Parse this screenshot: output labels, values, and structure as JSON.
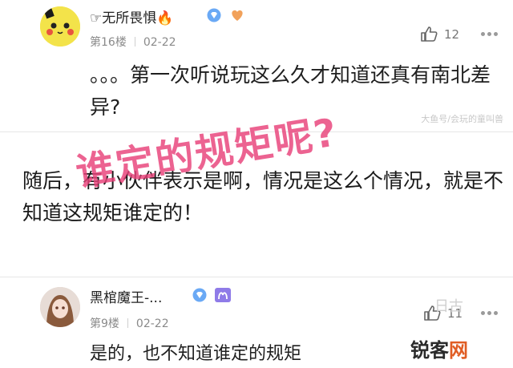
{
  "top_comment": {
    "username": "☞无所畏惧🔥",
    "floor": "第16楼",
    "date": "02-22",
    "likes": "12",
    "text": "。。。第一次听说玩这么久才知道还真有南北差异?",
    "watermark": "大鱼号/会玩的童叫兽"
  },
  "article": {
    "text": "随后，有小伙伴表示是啊，情况是这么个情况，就是不知道这规矩谁定的！"
  },
  "overlay": {
    "text": "谁定的规矩呢?",
    "color": "#e8427a"
  },
  "bottom_comment": {
    "username": "黑棺魔王-...",
    "floor": "第9楼",
    "date": "02-22",
    "likes": "11",
    "text": "是的，也不知道谁定的规矩",
    "watermark": "日古"
  },
  "site_logo": {
    "brand_part1": "锐客",
    "brand_part2": "网",
    "accent_color": "#e05d24"
  },
  "icons": [
    "avatar-pikachu",
    "fire-icon",
    "diamond-badge-icon",
    "heart-badge-icon",
    "thumb-up-icon",
    "more-icon",
    "aries-badge-icon"
  ]
}
